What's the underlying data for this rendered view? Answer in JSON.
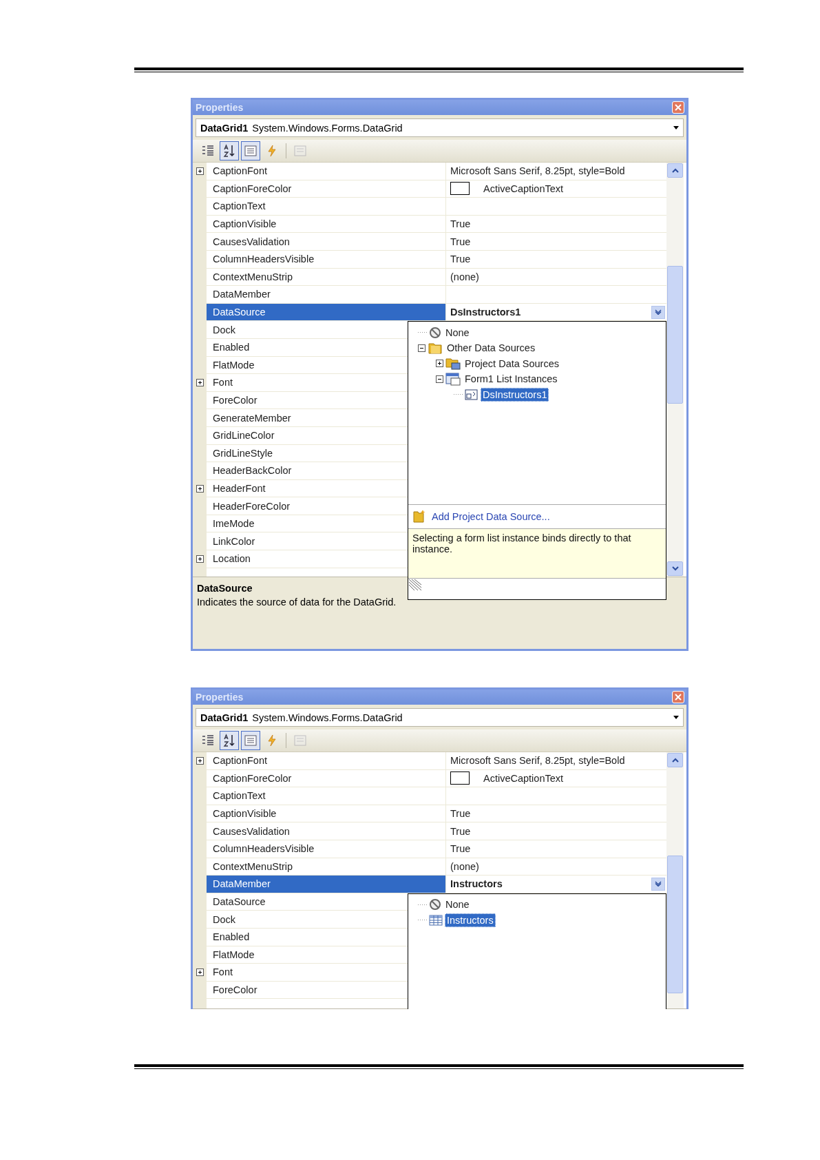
{
  "panels": [
    {
      "title": "Properties",
      "object": {
        "name": "DataGrid1",
        "type": "System.Windows.Forms.DataGrid"
      },
      "toolbar": [
        {
          "kind": "categorized",
          "selected": false,
          "disabled": false
        },
        {
          "kind": "alphabetical",
          "selected": true,
          "disabled": false
        },
        {
          "kind": "properties",
          "selected": true,
          "disabled": false
        },
        {
          "kind": "events",
          "selected": false,
          "disabled": false
        },
        {
          "kind": "pages",
          "selected": false,
          "disabled": true
        }
      ],
      "rows": [
        {
          "name": "CaptionFont",
          "expander": true,
          "selected": false,
          "kind": "plain",
          "value": "Microsoft Sans Serif, 8.25pt, style=Bold"
        },
        {
          "name": "CaptionForeColor",
          "expander": false,
          "selected": false,
          "kind": "swatch",
          "value": "ActiveCaptionText"
        },
        {
          "name": "CaptionText",
          "expander": false,
          "selected": false,
          "kind": "plain"
        },
        {
          "name": "CaptionVisible",
          "expander": false,
          "selected": false,
          "kind": "plain",
          "value": "True"
        },
        {
          "name": "CausesValidation",
          "expander": false,
          "selected": false,
          "kind": "plain",
          "value": "True"
        },
        {
          "name": "ColumnHeadersVisible",
          "expander": false,
          "selected": false,
          "kind": "plain",
          "value": "True"
        },
        {
          "name": "ContextMenuStrip",
          "expander": false,
          "selected": false,
          "kind": "plain",
          "value": "(none)"
        },
        {
          "name": "DataMember",
          "expander": false,
          "selected": false,
          "kind": "plain"
        },
        {
          "name": "DataSource",
          "expander": false,
          "selected": true,
          "kind": "dropdown",
          "value": "DsInstructors1"
        },
        {
          "name": "Dock",
          "expander": false,
          "selected": false,
          "kind": "plain"
        },
        {
          "name": "Enabled",
          "expander": false,
          "selected": false,
          "kind": "plain"
        },
        {
          "name": "FlatMode",
          "expander": false,
          "selected": false,
          "kind": "plain"
        },
        {
          "name": "Font",
          "expander": true,
          "selected": false,
          "kind": "plain"
        },
        {
          "name": "ForeColor",
          "expander": false,
          "selected": false,
          "kind": "plain"
        },
        {
          "name": "GenerateMember",
          "expander": false,
          "selected": false,
          "kind": "plain"
        },
        {
          "name": "GridLineColor",
          "expander": false,
          "selected": false,
          "kind": "plain"
        },
        {
          "name": "GridLineStyle",
          "expander": false,
          "selected": false,
          "kind": "plain"
        },
        {
          "name": "HeaderBackColor",
          "expander": false,
          "selected": false,
          "kind": "plain"
        },
        {
          "name": "HeaderFont",
          "expander": true,
          "selected": false,
          "kind": "plain"
        },
        {
          "name": "HeaderForeColor",
          "expander": false,
          "selected": false,
          "kind": "plain"
        },
        {
          "name": "ImeMode",
          "expander": false,
          "selected": false,
          "kind": "plain"
        },
        {
          "name": "LinkColor",
          "expander": false,
          "selected": false,
          "kind": "plain"
        },
        {
          "name": "Location",
          "expander": true,
          "selected": false,
          "kind": "plain"
        }
      ],
      "popup": {
        "tree": [
          {
            "label": "None",
            "kind": "none",
            "selected": false
          },
          {
            "label": "Other Data Sources",
            "kind": "folder",
            "expanded": true,
            "selected": false,
            "children": [
              {
                "label": "Project Data Sources",
                "kind": "data-folder",
                "expanded": false,
                "selected": false
              },
              {
                "label": "Form1 List Instances",
                "kind": "form",
                "expanded": true,
                "selected": false,
                "children": [
                  {
                    "label": "DsInstructors1",
                    "kind": "dataset",
                    "selected": true
                  }
                ]
              }
            ]
          }
        ],
        "link": "Add Project Data Source...",
        "hint": "Selecting a form list instance binds directly to that instance."
      },
      "description": {
        "title": "DataSource",
        "text": "Indicates the source of data for the DataGrid."
      }
    },
    {
      "title": "Properties",
      "object": {
        "name": "DataGrid1",
        "type": "System.Windows.Forms.DataGrid"
      },
      "toolbar": [
        {
          "kind": "categorized",
          "selected": false,
          "disabled": false
        },
        {
          "kind": "alphabetical",
          "selected": true,
          "disabled": false
        },
        {
          "kind": "properties",
          "selected": true,
          "disabled": false
        },
        {
          "kind": "events",
          "selected": false,
          "disabled": false
        },
        {
          "kind": "pages",
          "selected": false,
          "disabled": true
        }
      ],
      "rows": [
        {
          "name": "CaptionFont",
          "expander": true,
          "selected": false,
          "kind": "plain",
          "value": "Microsoft Sans Serif, 8.25pt, style=Bold"
        },
        {
          "name": "CaptionForeColor",
          "expander": false,
          "selected": false,
          "kind": "swatch",
          "value": "ActiveCaptionText"
        },
        {
          "name": "CaptionText",
          "expander": false,
          "selected": false,
          "kind": "plain"
        },
        {
          "name": "CaptionVisible",
          "expander": false,
          "selected": false,
          "kind": "plain",
          "value": "True"
        },
        {
          "name": "CausesValidation",
          "expander": false,
          "selected": false,
          "kind": "plain",
          "value": "True"
        },
        {
          "name": "ColumnHeadersVisible",
          "expander": false,
          "selected": false,
          "kind": "plain",
          "value": "True"
        },
        {
          "name": "ContextMenuStrip",
          "expander": false,
          "selected": false,
          "kind": "plain",
          "value": "(none)"
        },
        {
          "name": "DataMember",
          "expander": false,
          "selected": true,
          "kind": "dropdown",
          "value": "Instructors"
        },
        {
          "name": "DataSource",
          "expander": false,
          "selected": false,
          "kind": "plain"
        },
        {
          "name": "Dock",
          "expander": false,
          "selected": false,
          "kind": "plain"
        },
        {
          "name": "Enabled",
          "expander": false,
          "selected": false,
          "kind": "plain"
        },
        {
          "name": "FlatMode",
          "expander": false,
          "selected": false,
          "kind": "plain"
        },
        {
          "name": "Font",
          "expander": true,
          "selected": false,
          "kind": "plain"
        },
        {
          "name": "ForeColor",
          "expander": false,
          "selected": false,
          "kind": "plain"
        }
      ],
      "popup": {
        "tree": [
          {
            "label": "None",
            "kind": "none",
            "selected": false
          },
          {
            "label": "Instructors",
            "kind": "table",
            "selected": true
          }
        ]
      }
    }
  ]
}
